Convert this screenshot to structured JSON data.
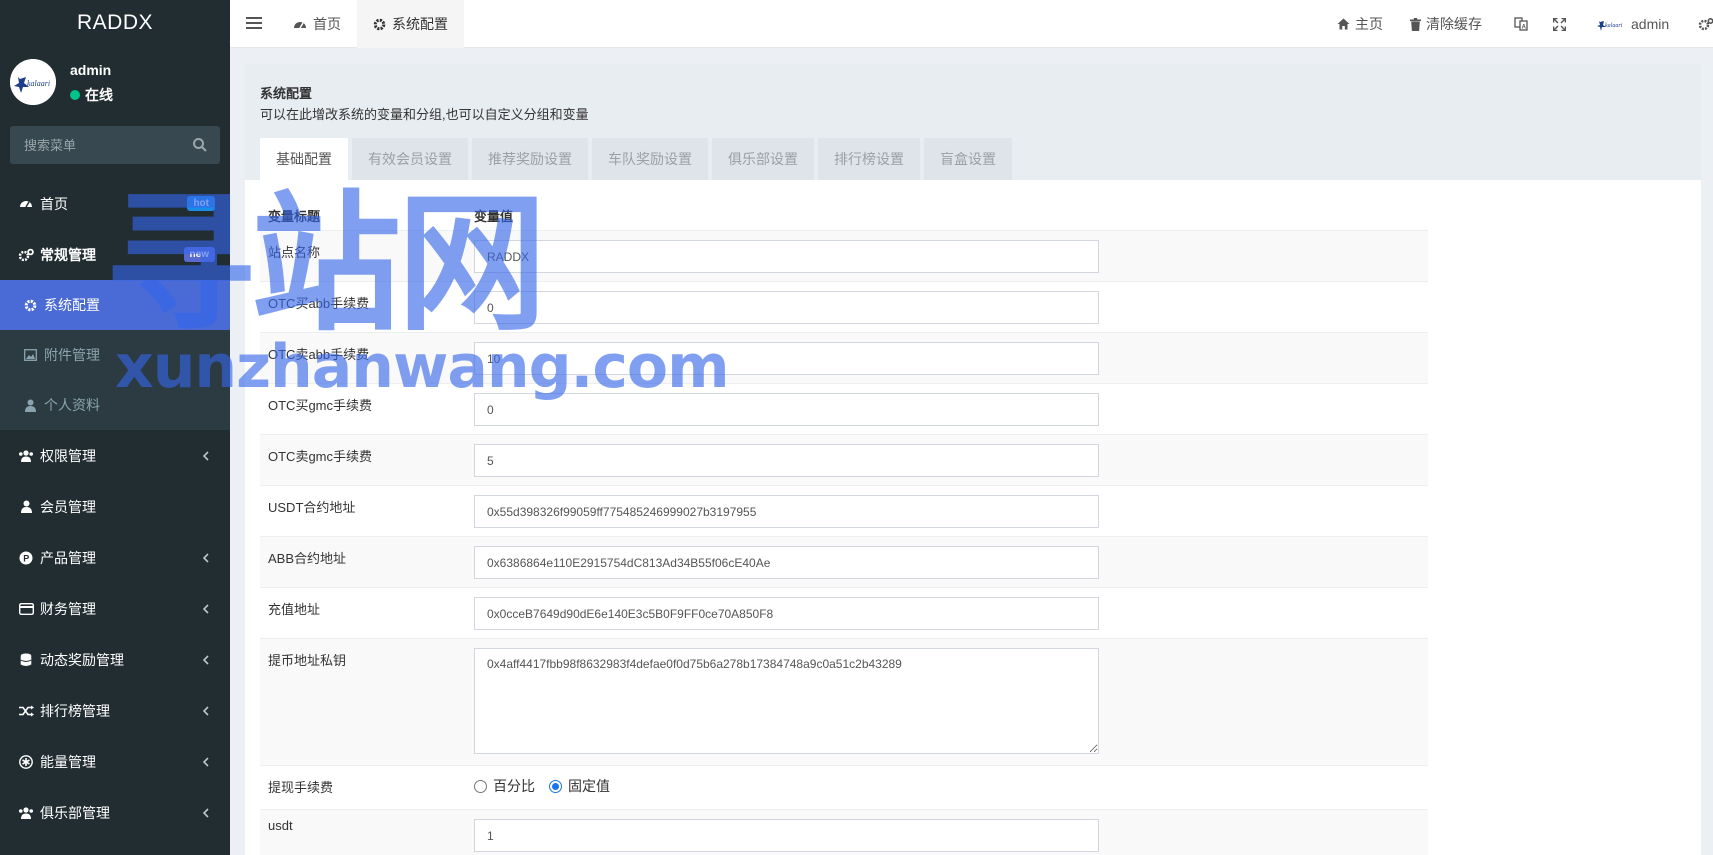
{
  "app": {
    "title": "RADDX"
  },
  "user": {
    "name": "admin",
    "status": "在线",
    "status_color": "#00c48c"
  },
  "search": {
    "placeholder": "搜索菜单"
  },
  "sidebar": {
    "items": [
      {
        "label": "首页",
        "icon": "dashboard-icon",
        "badge": "hot",
        "badge_color": "#1a8ce6"
      },
      {
        "label": "常规管理",
        "icon": "cogs-icon",
        "badge": "new",
        "badge_color": "#5b6ad1"
      },
      {
        "label": "权限管理",
        "icon": "users-icon"
      },
      {
        "label": "会员管理",
        "icon": "user-icon"
      },
      {
        "label": "产品管理",
        "icon": "product-icon"
      },
      {
        "label": "财务管理",
        "icon": "credit-card-icon"
      },
      {
        "label": "动态奖励管理",
        "icon": "database-icon"
      },
      {
        "label": "排行榜管理",
        "icon": "random-icon"
      },
      {
        "label": "能量管理",
        "icon": "asterisk-icon"
      },
      {
        "label": "俱乐部管理",
        "icon": "users-icon"
      }
    ],
    "submenu": [
      {
        "label": "系统配置",
        "icon": "gear-icon",
        "active": true
      },
      {
        "label": "附件管理",
        "icon": "image-icon"
      },
      {
        "label": "个人资料",
        "icon": "user-icon"
      }
    ]
  },
  "header": {
    "tabs": [
      {
        "label": "首页",
        "icon": "dashboard-icon"
      },
      {
        "label": "系统配置",
        "icon": "gear-icon"
      }
    ],
    "home_label": "主页",
    "clear_cache_label": "清除缓存",
    "admin_label": "admin"
  },
  "panel": {
    "title": "系统配置",
    "description": "可以在此增改系统的变量和分组,也可以自定义分组和变量",
    "tabs": [
      "基础配置",
      "有效会员设置",
      "推荐奖励设置",
      "车队奖励设置",
      "俱乐部设置",
      "排行榜设置",
      "盲盒设置"
    ]
  },
  "table": {
    "col_title": "变量标题",
    "col_value": "变量值",
    "rows": [
      {
        "label": "站点名称",
        "value": "RADDX"
      },
      {
        "label": "OTC买abb手续费",
        "value": "0"
      },
      {
        "label": "OTC卖abb手续费",
        "value": "10"
      },
      {
        "label": "OTC买gmc手续费",
        "value": "0"
      },
      {
        "label": "OTC卖gmc手续费",
        "value": "5"
      },
      {
        "label": "USDT合约地址",
        "value": "0x55d398326f99059ff775485246999027b3197955"
      },
      {
        "label": "ABB合约地址",
        "value": "0x6386864e110E2915754dC813Ad34B55f06cE40Ae"
      },
      {
        "label": "充值地址",
        "value": "0x0cceB7649d90dE6e140E3c5B0F9FF0ce70A850F8"
      }
    ],
    "textarea_row": {
      "label": "提币地址私钥",
      "value": "0x4aff4417fbb98f8632983f4defae0f0d75b6a278b17384748a9c0a51c2b43289"
    },
    "fee_row": {
      "label": "提现手续费",
      "options": [
        "百分比",
        "固定值"
      ],
      "selected": "固定值"
    },
    "last_row": {
      "label": "usdt",
      "value": "1"
    }
  },
  "watermark": {
    "text": "寻站网",
    "url_text": "xunzhanwang.com"
  },
  "colors": {
    "sidebar_bg": "#222d32",
    "accent": "#4a6bd6",
    "header_bg": "#ffffff"
  }
}
